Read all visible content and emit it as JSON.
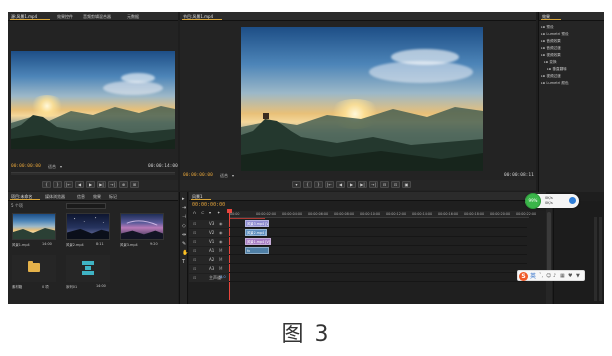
{
  "caption": "图 3",
  "source_monitor": {
    "tabs": [
      "源:风景1.mp4",
      "效果控件",
      "音频剪辑混合器",
      "元数据"
    ],
    "timecode_in": "00:00:00:00",
    "fit_label": "适合",
    "timecode_out": "00:00:14:00"
  },
  "program_monitor": {
    "tab": "节目:风景1.mp4",
    "timecode_in": "00:00:00:00",
    "fit_label": "适合",
    "timecode_out": "00:00:08:11"
  },
  "transport": {
    "source": [
      "{",
      "}",
      "|←",
      "◀",
      "▶",
      "▶|",
      "→|",
      "⊕",
      "⊞"
    ],
    "program": [
      "▾",
      "{",
      "}",
      "|←",
      "◀",
      "▶",
      "▶|",
      "→|",
      "⊟",
      "⊡",
      "▣"
    ]
  },
  "project": {
    "tabs": [
      "项目:未命名",
      "媒体浏览器",
      "信息",
      "效果",
      "标记"
    ],
    "search_placeholder": "",
    "item_count": "5 个项",
    "items": [
      {
        "label": "风景1.mp4",
        "duration": "14:00"
      },
      {
        "label": "风景2.mp4",
        "duration": "8:11"
      },
      {
        "label": "风景3.mp4",
        "duration": "9:20"
      },
      {
        "label": "素材箱",
        "duration": "0 项"
      },
      {
        "label": "序列01",
        "duration": "14:00"
      }
    ]
  },
  "timeline": {
    "tab": "风景1",
    "timecode": "00:00:00:00",
    "ruler": [
      "00:00",
      "00:00:02:00",
      "00:00:04:00",
      "00:00:06:00",
      "00:00:08:00",
      "00:00:10:00",
      "00:00:12:00",
      "00:00:14:00",
      "00:00:16:00",
      "00:00:18:00",
      "00:00:20:00",
      "00:00:22:00"
    ],
    "tracks": [
      {
        "name": "V3"
      },
      {
        "name": "V2"
      },
      {
        "name": "V1"
      },
      {
        "name": "A1"
      },
      {
        "name": "A2"
      },
      {
        "name": "A3"
      },
      {
        "name": "主声道"
      }
    ],
    "clips": {
      "v3": "风景3.mp4 [V]",
      "v2": "风景2.mp4 [V]",
      "v1": "风景1.mp4 [V]",
      "a1": "fx"
    },
    "master_level": "0.0"
  },
  "right_panel": {
    "title": "效果",
    "items": [
      "预设",
      "Lumetri 预设",
      "音频效果",
      "音频过渡",
      "视频效果",
      "变换",
      "垂直翻转",
      "视频过渡",
      "Lumetri 颜色"
    ]
  },
  "overlay": {
    "badge_text": "99%",
    "speed_up": "0K/s",
    "speed_down": "0K/s"
  },
  "ime": {
    "logo": "S",
    "lang": "英"
  },
  "colors": {
    "accent": "#e5a43a",
    "badge": "#3bb54a",
    "clip_v3": "#8d8bd1",
    "clip_v2": "#5f8fbf",
    "clip_v1": "#a77ec4",
    "clip_a1": "#4f7fa6"
  }
}
